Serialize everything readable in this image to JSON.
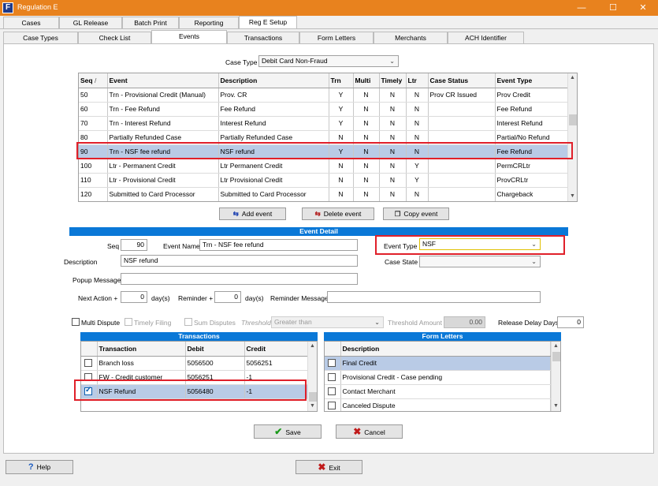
{
  "window": {
    "title": "Regulation E",
    "app_icon_letter": "F",
    "minimize": "—",
    "maximize": "☐",
    "close": "✕"
  },
  "main_tabs": [
    "Cases",
    "GL Release",
    "Batch Print",
    "Reporting",
    "Reg E Setup"
  ],
  "sub_tabs": [
    "Case Types",
    "Check List",
    "Events",
    "Transactions",
    "Form Letters",
    "Merchants",
    "ACH Identifier"
  ],
  "case_type": {
    "label": "Case Type",
    "value": "Debit Card Non-Fraud"
  },
  "events_grid": {
    "columns": [
      "Seq",
      "Event",
      "Description",
      "Trn",
      "Multi",
      "Timely",
      "Ltr",
      "Case Status",
      "Event Type"
    ],
    "sort_indicator": "/",
    "rows": [
      [
        "50",
        "Trn - Provisional Credit (Manual)",
        "Prov. CR",
        "Y",
        "N",
        "N",
        "N",
        "Prov CR Issued",
        "Prov Credit"
      ],
      [
        "60",
        "Trn - Fee Refund",
        "Fee Refund",
        "Y",
        "N",
        "N",
        "N",
        "",
        "Fee Refund"
      ],
      [
        "70",
        "Trn - Interest Refund",
        "Interest Refund",
        "Y",
        "N",
        "N",
        "N",
        "",
        "Interest Refund"
      ],
      [
        "80",
        "Partially Refunded Case",
        "Partially Refunded Case",
        "N",
        "N",
        "N",
        "N",
        "",
        "Partial/No Refund"
      ],
      [
        "90",
        "Trn - NSF fee refund",
        "NSF refund",
        "Y",
        "N",
        "N",
        "N",
        "",
        "Fee Refund"
      ],
      [
        "100",
        "Ltr - Permanent Credit",
        "Ltr Permanent Credit",
        "N",
        "N",
        "N",
        "Y",
        "",
        "PermCRLtr"
      ],
      [
        "110",
        "Ltr - Provisional Credit",
        "Ltr Provisional Credit",
        "N",
        "N",
        "N",
        "Y",
        "",
        "ProvCRLtr"
      ],
      [
        "120",
        "Submitted to Card Processor",
        "Submitted to Card Processor",
        "N",
        "N",
        "N",
        "N",
        "",
        "Chargeback"
      ]
    ]
  },
  "event_buttons": {
    "add": "Add event",
    "delete": "Delete event",
    "copy": "Copy event"
  },
  "event_detail": {
    "header": "Event Detail",
    "seq_label": "Seq",
    "seq_value": "90",
    "event_name_label": "Event Name",
    "event_name_value": "Trn - NSF fee refund",
    "description_label": "Description",
    "description_value": "NSF refund",
    "popup_label": "Popup Message",
    "popup_value": "",
    "event_type_label": "Event Type",
    "event_type_value": "NSF",
    "case_state_label": "Case State",
    "case_state_value": "",
    "next_action_label": "Next Action +",
    "next_action_value": "0",
    "next_action_unit": "day(s)",
    "reminder_label": "Reminder +",
    "reminder_value": "0",
    "reminder_unit": "day(s)",
    "reminder_message_label": "Reminder Message",
    "reminder_message_value": "",
    "multi_dispute": "Multi Dispute",
    "timely_filing": "Timely Filing",
    "sum_disputes": "Sum Disputes",
    "threshold_label": "Threshold",
    "threshold_value": "Greater than",
    "threshold_amount_label": "Threshold Amount",
    "threshold_amount_value": "0.00",
    "release_delay_label": "Release Delay Days",
    "release_delay_value": "0"
  },
  "transactions": {
    "header": "Transactions",
    "columns": [
      "Transaction",
      "Debit",
      "Credit"
    ],
    "rows": [
      {
        "checked": false,
        "cells": [
          "Branch loss",
          "5056500",
          "5056251"
        ]
      },
      {
        "checked": false,
        "cells": [
          "FW - Credit customer",
          "5056251",
          "-1"
        ]
      },
      {
        "checked": true,
        "cells": [
          "NSF Refund",
          "5056480",
          "-1"
        ]
      }
    ]
  },
  "form_letters": {
    "header": "Form Letters",
    "columns": [
      "Description"
    ],
    "rows": [
      "Final Credit",
      "Provisional Credit - Case pending",
      "Contact Merchant",
      "Canceled Dispute"
    ]
  },
  "actions": {
    "save": "Save",
    "cancel": "Cancel"
  },
  "footer": {
    "help": "Help",
    "exit": "Exit"
  },
  "colors": {
    "title_bar": "#e8821e",
    "section_header": "#0a78d7",
    "selection": "#b9cbe6",
    "highlight_box": "#e0202a"
  }
}
